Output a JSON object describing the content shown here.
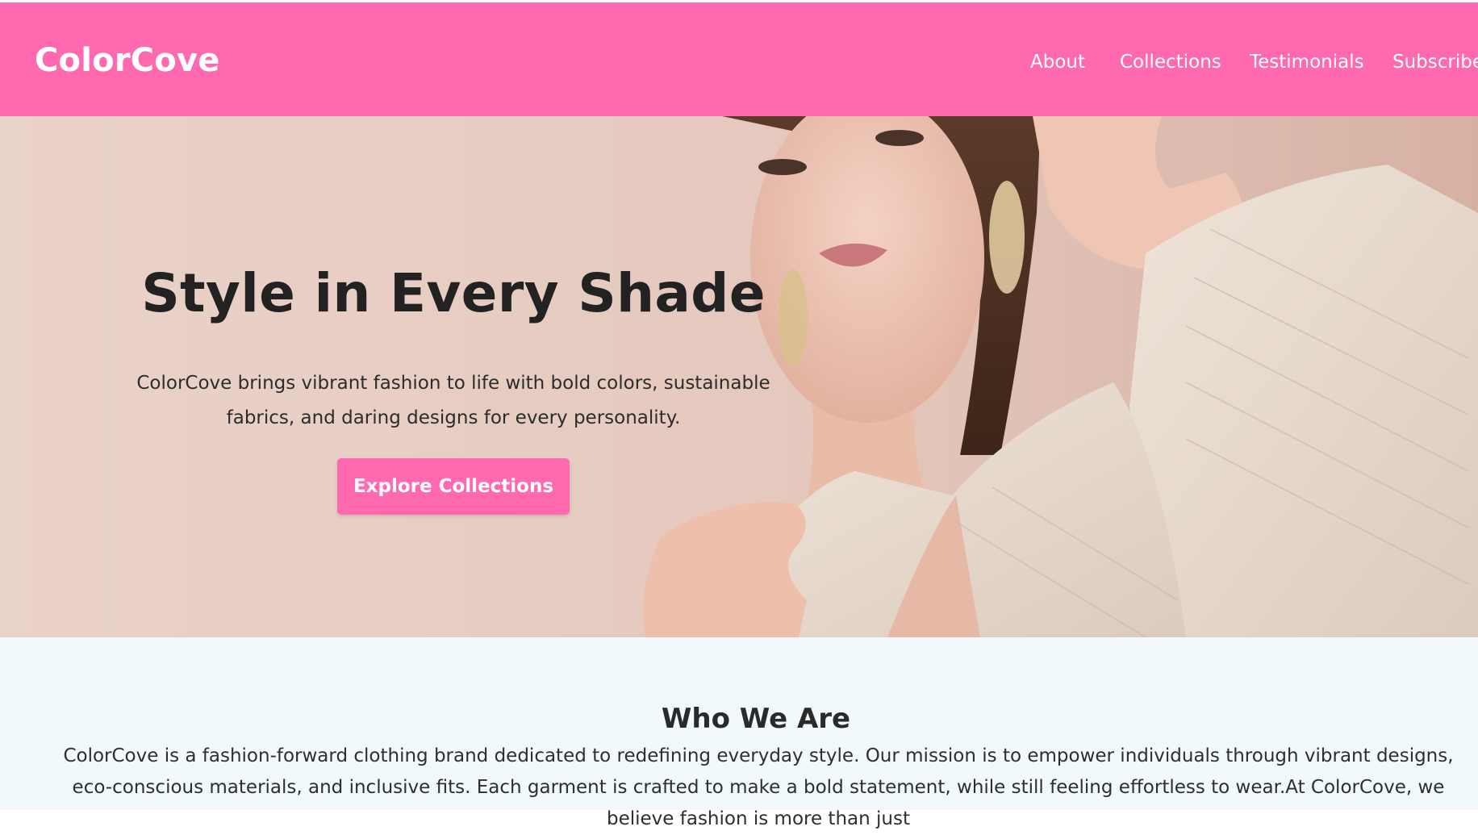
{
  "header": {
    "logo": "ColorCove",
    "nav": [
      "About",
      "Collections",
      "Testimonials",
      "Subscribe"
    ]
  },
  "hero": {
    "title": "Style in Every Shade",
    "description": "ColorCove brings vibrant fashion to life with bold colors, sustainable fabrics, and daring designs for every personality.",
    "button_label": "Explore Collections",
    "image": "hero-model-photo"
  },
  "about": {
    "title": "Who We Are",
    "text": "ColorCove is a fashion-forward clothing brand dedicated to redefining everyday style. Our mission is to empower individuals through vibrant designs, eco-conscious materials, and inclusive fits. Each garment is crafted to make a bold statement, while still feeling effortless to wear.At ColorCove, we believe fashion is more than just"
  },
  "colors": {
    "brand_pink": "#ff69b0",
    "hero_background": "#e7cfc5",
    "about_background": "#f2f9fd",
    "text_dark": "#222222"
  }
}
